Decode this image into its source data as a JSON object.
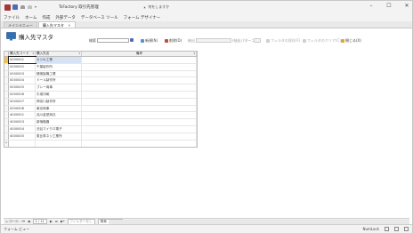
{
  "titlebar": {
    "title": "TsFactory 取引先管理",
    "search_label": "何をしますか",
    "colors": {
      "access": "#a4373a",
      "save": "#4f6cb2"
    }
  },
  "ribbon": {
    "tabs": [
      "ファイル",
      "ホーム",
      "作成",
      "外部データ",
      "データベース ツール",
      "フォーム デザイナー"
    ]
  },
  "doc_tabs": [
    {
      "label": "メインメニュー",
      "active": false
    },
    {
      "label": "購入先マスタ",
      "active": true
    }
  ],
  "form": {
    "title": "購入先マスタ",
    "toolbar": {
      "search_label": "検索",
      "new_label": "新規(N)",
      "delete_label": "削除(D)",
      "filter_label": "抽出",
      "pattern_label": "(抽出パターン)",
      "save_filter_label": "フィルタの保存(F)",
      "clear_filter_label": "フィルタのクリア(C)",
      "close_label": "閉じる(X)"
    },
    "grid": {
      "columns": [
        "購入先コード",
        "購入先名",
        "備考"
      ],
      "rows": [
        {
          "code": "0000001",
          "name": "カジキ工業",
          "note": ""
        },
        {
          "code": "0000002",
          "name": "千葉製作所",
          "note": ""
        },
        {
          "code": "0000003",
          "name": "猪俣製機工業",
          "note": ""
        },
        {
          "code": "0000004",
          "name": "ドール製作所",
          "note": ""
        },
        {
          "code": "0000005",
          "name": "ブレー商事",
          "note": ""
        },
        {
          "code": "0000006",
          "name": "平成印刷",
          "note": ""
        },
        {
          "code": "0000007",
          "name": "神奈川製作所",
          "note": ""
        },
        {
          "code": "0000008",
          "name": "東京商事",
          "note": ""
        },
        {
          "code": "4000001",
          "name": "品川金型商社",
          "note": ""
        },
        {
          "code": "4000003",
          "name": "新宿機器",
          "note": ""
        },
        {
          "code": "4000004",
          "name": "渋谷マイクロ電子",
          "note": ""
        },
        {
          "code": "4000005",
          "name": "恵比寿ネジ工業所",
          "note": ""
        }
      ],
      "new_row_marker": "*"
    }
  },
  "navbar": {
    "record_label": "レコード: ",
    "position": "1 / 11",
    "filter_state": "フィルターなし",
    "search_label": "検索"
  },
  "statusbar": {
    "view": "フォーム ビュー",
    "numlock": "NumLock"
  }
}
